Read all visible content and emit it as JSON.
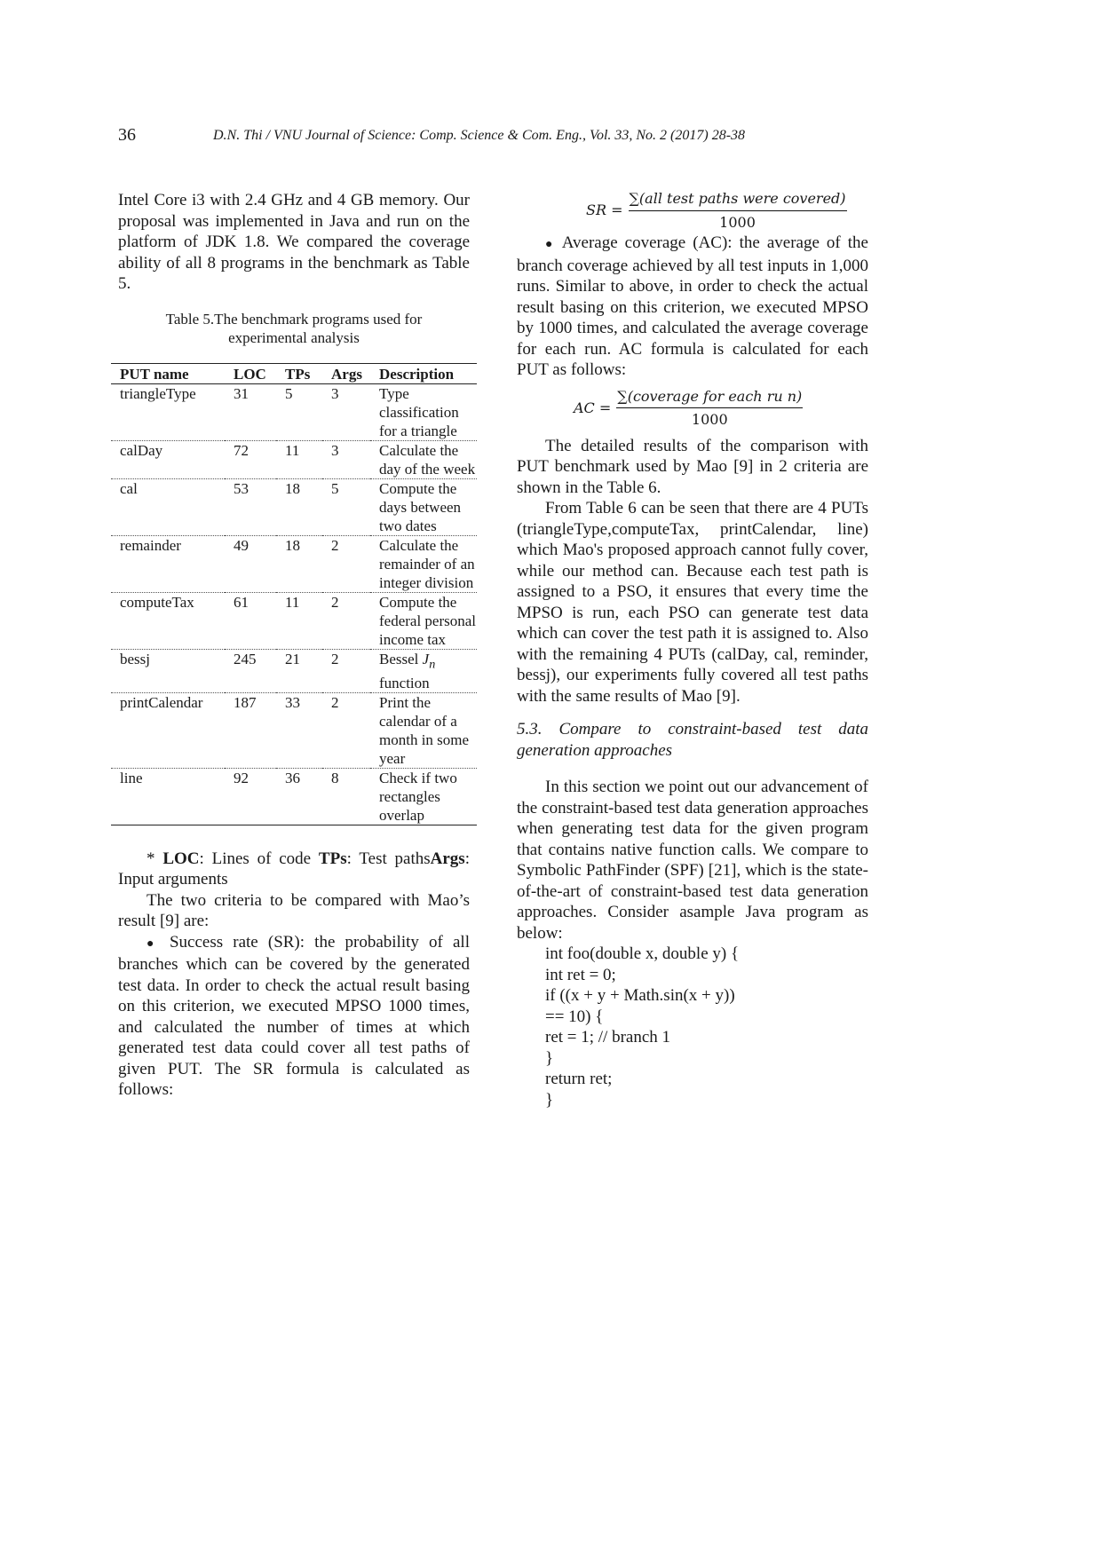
{
  "header": {
    "page_number": "36",
    "journal": "D.N. Thi / VNU Journal of Science: Comp. Science & Com. Eng., Vol. 33, No. 2 (2017) 28-38"
  },
  "left": {
    "intro": "Intel Core i3 with 2.4 GHz and 4 GB memory. Our proposal was implemented in Java and run on the platform of JDK 1.8. We compared the coverage ability of all 8 programs in the benchmark as Table 5.",
    "table_caption_1": "Table 5.The benchmark programs used for",
    "table_caption_2": "experimental analysis",
    "table": {
      "headers": [
        "PUT name",
        "LOC",
        "TPs",
        "Args",
        "Description"
      ],
      "rows": [
        {
          "name": "triangleType",
          "loc": "31",
          "tps": "5",
          "args": "3",
          "desc": "Type classification for a triangle"
        },
        {
          "name": "calDay",
          "loc": "72",
          "tps": "11",
          "args": "3",
          "desc": "Calculate the day of the week"
        },
        {
          "name": "cal",
          "loc": "53",
          "tps": "18",
          "args": "5",
          "desc": "Compute the days between two dates"
        },
        {
          "name": "remainder",
          "loc": "49",
          "tps": "18",
          "args": "2",
          "desc": "Calculate the remainder of an integer division"
        },
        {
          "name": "computeTax",
          "loc": "61",
          "tps": "11",
          "args": "2",
          "desc": "Compute the federal personal income tax"
        },
        {
          "name": "bessj",
          "loc": "245",
          "tps": "21",
          "args": "2",
          "desc_prefix": "Bessel ",
          "desc_italic": "J",
          "desc_sub": "n",
          "desc_suffix": " function"
        },
        {
          "name": "printCalendar",
          "loc": "187",
          "tps": "33",
          "args": "2",
          "desc": "Print the calendar of a month in some year"
        },
        {
          "name": "line",
          "loc": "92",
          "tps": "36",
          "args": "8",
          "desc": "Check if two rectangles overlap"
        }
      ]
    },
    "footnote": {
      "star": "* ",
      "loc_label": "LOC",
      "loc_text": ": Lines of code ",
      "tps_label": "TPs",
      "tps_text": ": Test paths",
      "args_label": "Args",
      "args_text": ": Input arguments"
    },
    "criteria_intro": "The two criteria to be compared with Mao’s result [9] are:",
    "bullet_glyph": "●",
    "sr_paragraph": " Success rate (SR): the probability of all branches which can be covered by the generated test data. In order to check the actual result basing on this criterion, we executed MPSO 1000 times, and calculated the number of times at which generated test data could cover all test paths of given PUT. The SR formula is calculated as follows:"
  },
  "right": {
    "sr_formula": {
      "lhs": "SR =",
      "numerator": "∑(all test paths were covered)",
      "denominator": "1000"
    },
    "bullet_glyph": "●",
    "ac_paragraph": " Average coverage (AC): the average of the branch coverage achieved by all test inputs in 1,000 runs. Similar to above, in order to check the actual result basing on this criterion, we executed MPSO by 1000 times, and calculated the average coverage for each run. AC formula is calculated for each PUT as follows:",
    "ac_formula": {
      "lhs": "AC =",
      "numerator": "∑(coverage for each ru n)",
      "denominator": "1000"
    },
    "para_results": "The detailed results of the comparison with PUT benchmark used by Mao [9] in 2 criteria are shown in the Table 6.",
    "para_table6": "From Table 6 can be seen that there are 4 PUTs (triangleType,computeTax, printCalendar, line) which Mao's proposed approach cannot fully cover, while our method can. Because each test path is assigned to a PSO, it ensures that every time the MPSO is run, each PSO can generate test data which can cover the test path it is assigned to. Also with the remaining 4 PUTs (calDay, cal, reminder, bessj), our experiments fully covered all test paths with the same results of Mao [9].",
    "section_heading": "5.3. Compare to constraint-based test data generation approaches",
    "para_section": "In this section we point out our advancement of the constraint-based test data generation approaches when generating test data for the given program that contains native function calls. We compare to Symbolic PathFinder (SPF) [21], which is the state-of-the-art of constraint-based test data generation approaches. Consider asample Java program as below:",
    "code_lines": [
      "int foo(double x, double y) {",
      "int ret = 0;",
      "if ((x + y + Math.sin(x + y))",
      "== 10) {",
      "ret = 1; // branch 1",
      "}",
      "return ret;",
      "}"
    ]
  }
}
